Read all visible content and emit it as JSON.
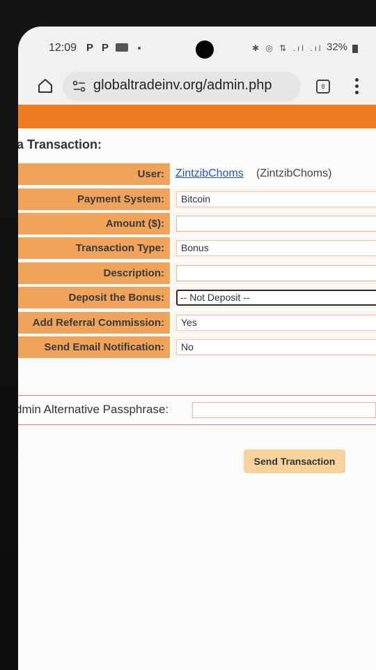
{
  "status_bar": {
    "time": "12:09",
    "notif_p1": "P",
    "notif_p2": "P",
    "icons": "✱ ◎ ⇅ .ıl .ıl",
    "battery": "32%"
  },
  "browser": {
    "url": "globaltradeinv.org/admin.php",
    "tab_count": "8"
  },
  "page": {
    "title": "a Transaction:",
    "user": {
      "label": "User:",
      "link": "ZintzibChoms",
      "sub": "(ZintzibChoms)"
    },
    "fields": [
      {
        "label": "Payment System:",
        "value": "Bitcoin"
      },
      {
        "label": "Amount ($):",
        "value": ""
      },
      {
        "label": "Transaction Type:",
        "value": "Bonus"
      },
      {
        "label": "Description:",
        "value": ""
      },
      {
        "label": "Deposit the Bonus:",
        "value": "-- Not Deposit --"
      },
      {
        "label": "Add Referral Commission:",
        "value": "Yes"
      },
      {
        "label": "Send Email Notification:",
        "value": "No"
      }
    ],
    "passphrase_label": "dmin Alternative Passphrase:",
    "passphrase_value": "",
    "submit_label": "Send Transaction"
  },
  "colors": {
    "banner": "#f07b1e",
    "label_bg": "#f0a35a",
    "button": "#f6d39a",
    "link": "#2456b4"
  }
}
